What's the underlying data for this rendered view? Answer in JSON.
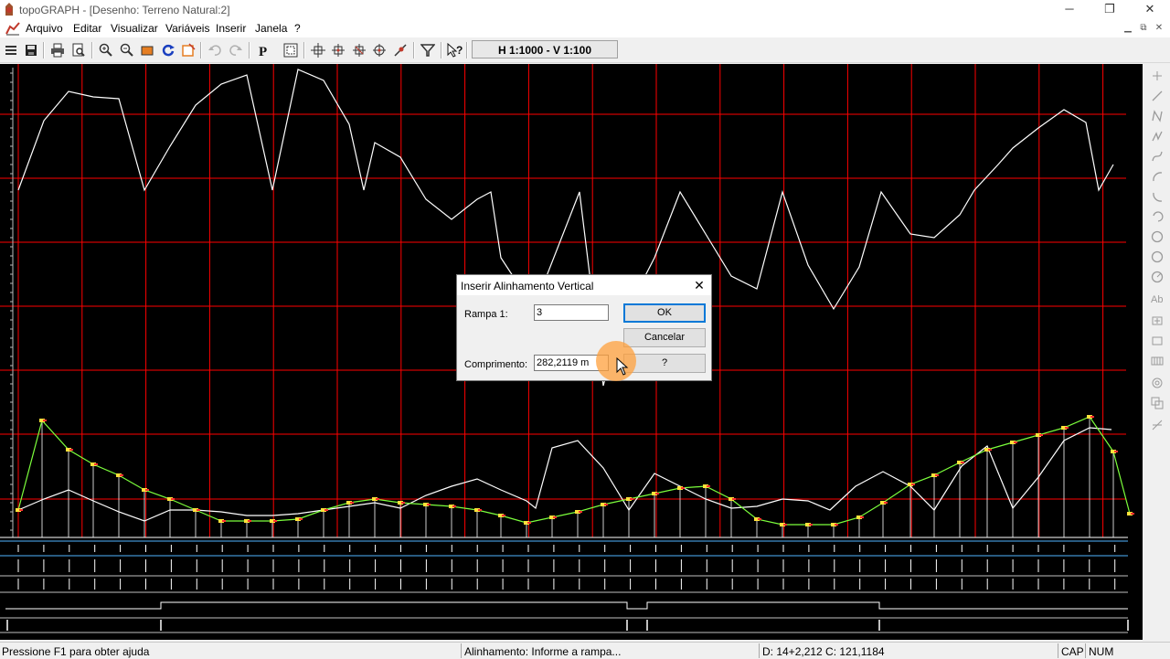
{
  "window": {
    "title": "topoGRAPH - [Desenho: Terreno Natural:2]",
    "controls": {
      "minimize": "─",
      "restore": "❐",
      "close": "✕"
    }
  },
  "menubar": {
    "items": [
      "Arquivo",
      "Editar",
      "Visualizar",
      "Variáveis",
      "Inserir",
      "Janela",
      "?"
    ],
    "mdi_controls": {
      "minimize": "▁",
      "restore": "⧉",
      "close": "✕"
    }
  },
  "toolbar": {
    "scale": "H 1:1000 - V 1:100",
    "buttons": [
      "menu-icon",
      "save-icon",
      "print-icon",
      "print-preview-icon",
      "zoom-in-icon",
      "zoom-out-icon",
      "zoom-window-icon",
      "redraw-icon",
      "zoom-extents-icon",
      "undo-icon",
      "redo-icon",
      "properties-icon",
      "select-window-icon",
      "move-icon",
      "snap-icon",
      "snap-center-icon",
      "snap-point-icon",
      "measure-icon",
      "filter-icon",
      "context-help-icon"
    ]
  },
  "dialog": {
    "title": "Inserir Alinhamento Vertical",
    "close": "✕",
    "rampa_label": "Rampa 1:",
    "rampa_value": "3",
    "comprimento_label": "Comprimento:",
    "comprimento_value": "282,2119 m",
    "ok_label": "OK",
    "cancel_label": "Cancelar",
    "help_label": "?"
  },
  "right_toolbar": [
    "point-icon",
    "line-icon",
    "polyline-icon",
    "spline-icon",
    "curve-icon",
    "arc-icon",
    "arc-2-icon",
    "arc-3-icon",
    "circle-icon",
    "circle-2-icon",
    "circle-3-icon",
    "text-icon",
    "insert-block-icon",
    "rectangle-icon",
    "hatch-icon",
    "rotate-icon",
    "copy-icon",
    "trim-icon"
  ],
  "statusbar": {
    "help": "Pressione F1 para obter ajuda",
    "prompt": "Alinhamento: Informe a rampa...",
    "coords": "D: 14+2,212 C: 121,1184",
    "cap": "CAP",
    "num": "NUM"
  },
  "colors": {
    "canvas_background": "#000000",
    "grid": "#ff0000",
    "terrain_profile": "#ffffff",
    "alignment_profile": "#7cff3c",
    "guitar_lines": "#4fb3ff",
    "dialog_highlight": "#0078d7"
  }
}
